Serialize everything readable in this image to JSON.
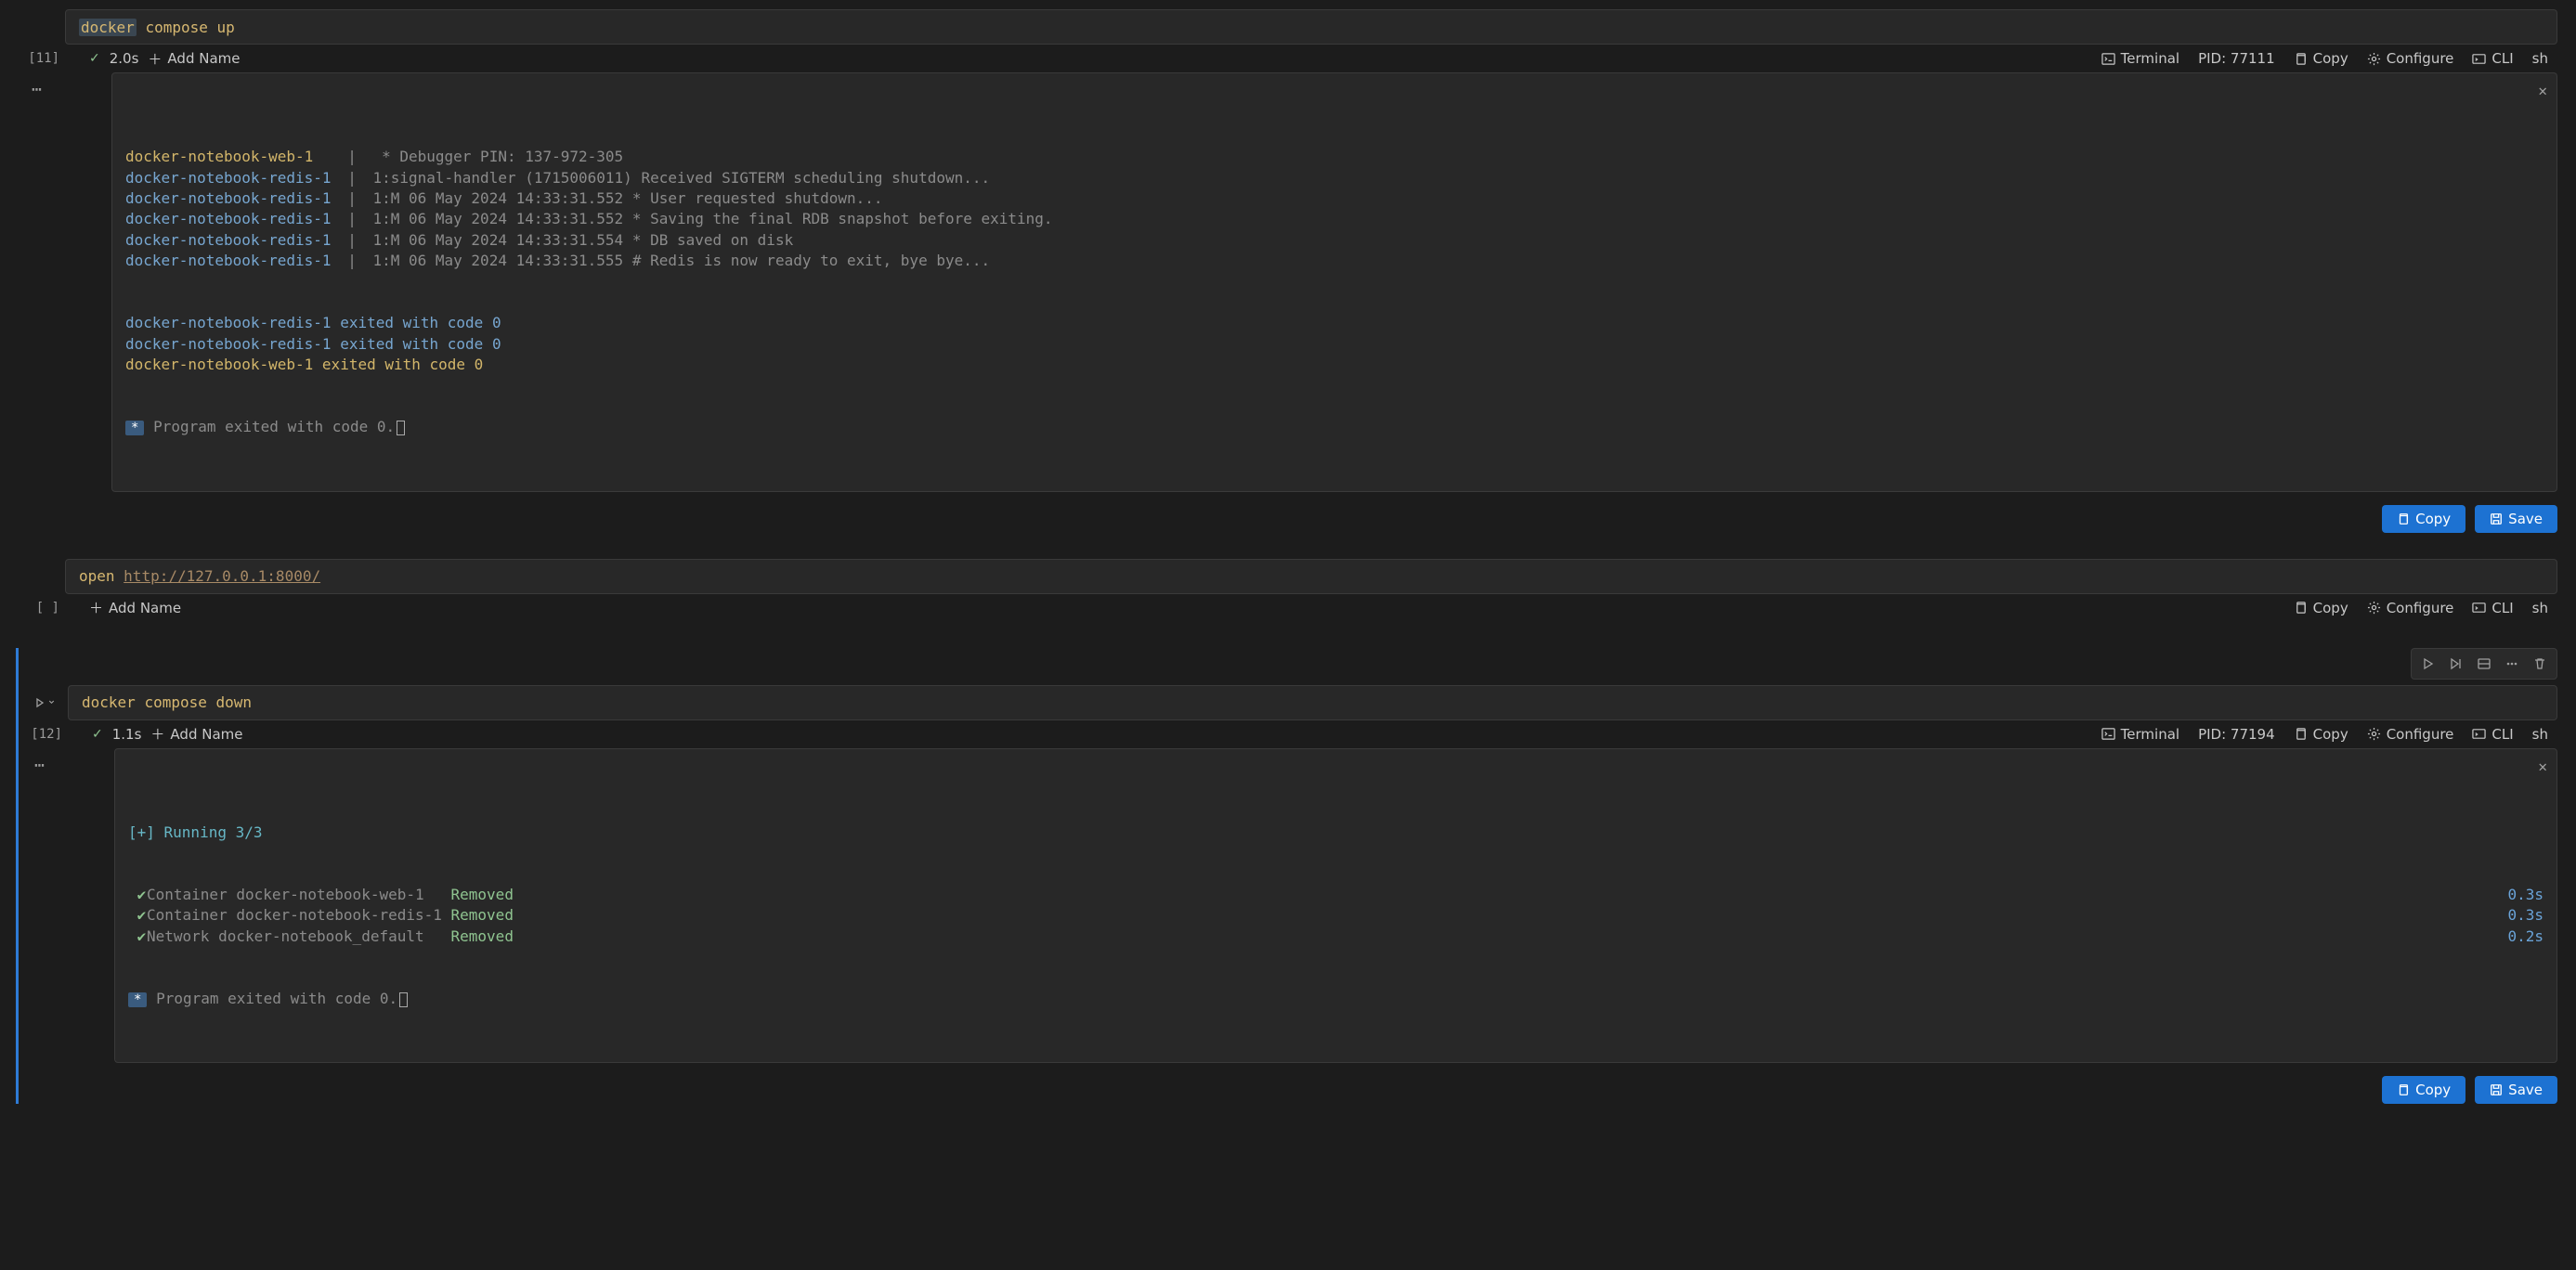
{
  "cells": [
    {
      "id": "c1",
      "num": "[11]",
      "status": "done",
      "time": "2.0s",
      "add_name": "Add Name",
      "terminal": "Terminal",
      "pid": "PID: 77111",
      "copy": "Copy",
      "configure": "Configure",
      "cli": "CLI",
      "shell": "sh",
      "command_parts": [
        {
          "text": "docker",
          "cls": "cmd-yellow sel"
        },
        {
          "text": " "
        },
        {
          "text": "compose",
          "cls": "cmd-yellow"
        },
        {
          "text": " "
        },
        {
          "text": "up",
          "cls": "cmd-yellow"
        }
      ],
      "output_lines": [
        {
          "svc": "docker-notebook-web-1",
          "svc_cls": "svc-web",
          "pipe": "|",
          "msg": "  * Debugger PIN: 137-972-305"
        },
        {
          "svc": "docker-notebook-redis-1",
          "svc_cls": "svc-redis",
          "pipe": "|",
          "msg": " 1:signal-handler (1715006011) Received SIGTERM scheduling shutdown..."
        },
        {
          "svc": "docker-notebook-redis-1",
          "svc_cls": "svc-redis",
          "pipe": "|",
          "msg": " 1:M 06 May 2024 14:33:31.552 * User requested shutdown..."
        },
        {
          "svc": "docker-notebook-redis-1",
          "svc_cls": "svc-redis",
          "pipe": "|",
          "msg": " 1:M 06 May 2024 14:33:31.552 * Saving the final RDB snapshot before exiting."
        },
        {
          "svc": "docker-notebook-redis-1",
          "svc_cls": "svc-redis",
          "pipe": "|",
          "msg": " 1:M 06 May 2024 14:33:31.554 * DB saved on disk"
        },
        {
          "svc": "docker-notebook-redis-1",
          "svc_cls": "svc-redis",
          "pipe": "|",
          "msg": " 1:M 06 May 2024 14:33:31.555 # Redis is now ready to exit, bye bye..."
        }
      ],
      "exit_lines": [
        {
          "text": "docker-notebook-redis-1 exited with code 0",
          "cls": "svc-redis"
        },
        {
          "text": "docker-notebook-redis-1 exited with code 0",
          "cls": "svc-redis"
        },
        {
          "text": "docker-notebook-web-1 exited with code 0",
          "cls": "svc-web"
        }
      ],
      "program_exit_badge": "*",
      "program_exit": " Program exited with code 0.",
      "copy_btn": "Copy",
      "save_btn": "Save"
    },
    {
      "id": "c2",
      "num": "[ ]",
      "add_name": "Add Name",
      "copy": "Copy",
      "configure": "Configure",
      "cli": "CLI",
      "shell": "sh",
      "command_parts": [
        {
          "text": "open",
          "cls": "cmd-yellow"
        },
        {
          "text": " "
        },
        {
          "text": "http://127.0.0.1:8000/",
          "cls": "cmd-link"
        }
      ]
    },
    {
      "id": "c3",
      "active": true,
      "num": "[12]",
      "status": "done",
      "time": "1.1s",
      "add_name": "Add Name",
      "terminal": "Terminal",
      "pid": "PID: 77194",
      "copy": "Copy",
      "configure": "Configure",
      "cli": "CLI",
      "shell": "sh",
      "command_parts": [
        {
          "text": "docker",
          "cls": "cmd-yellow"
        },
        {
          "text": " "
        },
        {
          "text": "compose",
          "cls": "cmd-yellow"
        },
        {
          "text": " "
        },
        {
          "text": "down",
          "cls": "cmd-yellow"
        }
      ],
      "running_line": "[+] Running 3/3",
      "down_lines": [
        {
          "tick": "✔",
          "name": "Container docker-notebook-web-1   ",
          "status": "Removed",
          "dur": "0.3s"
        },
        {
          "tick": "✔",
          "name": "Container docker-notebook-redis-1 ",
          "status": "Removed",
          "dur": "0.3s"
        },
        {
          "tick": "✔",
          "name": "Network docker-notebook_default   ",
          "status": "Removed",
          "dur": "0.2s"
        }
      ],
      "program_exit_badge": "*",
      "program_exit": " Program exited with code 0.",
      "copy_btn": "Copy",
      "save_btn": "Save"
    }
  ]
}
